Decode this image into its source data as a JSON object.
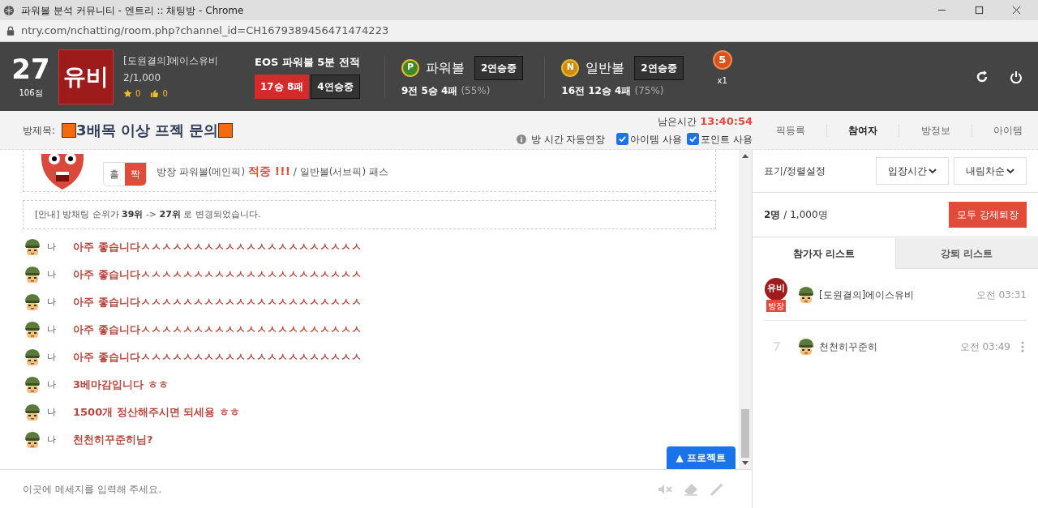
{
  "window": {
    "title": "파워볼 분석 커뮤니티 - 엔트리 :: 채팅방 - Chrome",
    "url": "ntry.com/nchatting/room.php?channel_id=CH1679389456471474223"
  },
  "header": {
    "rank": "27",
    "points": "106점",
    "badge_text": "유비",
    "user_name": "[도원결의]에이스유비",
    "members": "2/1,000",
    "stars": "0",
    "likes": "0",
    "record_title": "EOS 파워볼 5분 전적",
    "record": "17승 8패",
    "record_streak": "4연승중",
    "games": [
      {
        "kind": "powerball",
        "icon_letter": "P",
        "name": "파워볼",
        "streak": "2연승중",
        "stats": "9전 5승 4패",
        "rate": "(55%)"
      },
      {
        "kind": "normal",
        "icon_letter": "N",
        "name": "일반볼",
        "streak": "2연승중",
        "stats": "16전 12승 4패",
        "rate": "(75%)"
      }
    ],
    "medal": {
      "number": "5",
      "count": "x1"
    }
  },
  "room": {
    "title_label": "방제목:",
    "title": "3배목 이상 프젝 문의",
    "remaining_label": "남은시간",
    "remaining": "13:40:54",
    "auto_extend": "방 시간 자동연장",
    "options": [
      {
        "label": "아이템 사용",
        "checked": true
      },
      {
        "label": "포인트 사용",
        "checked": true
      }
    ]
  },
  "side_tabs": [
    {
      "label": "픽등록",
      "selected": false
    },
    {
      "label": "참여자",
      "selected": true
    },
    {
      "label": "방정보",
      "selected": false
    },
    {
      "label": "아이템",
      "selected": false
    }
  ],
  "chat": {
    "result_card": {
      "odd": "홀",
      "even": "짝",
      "even_selected": true,
      "text": "방장 파워볼(메인픽) **적중 !!!** / 일반볼(서브픽) 패스"
    },
    "notice": "[안내] 방채팅 순위가 **39위** -> **27위** 로 변경되었습니다.",
    "messages": [
      {
        "sender": "나",
        "text": "아주 좋습니다ㅅㅅㅅㅅㅅㅅㅅㅅㅅㅅㅅㅅㅅㅅㅅㅅㅅㅅㅅㅅㅅ"
      },
      {
        "sender": "나",
        "text": "아주 좋습니다ㅅㅅㅅㅅㅅㅅㅅㅅㅅㅅㅅㅅㅅㅅㅅㅅㅅㅅㅅㅅㅅ"
      },
      {
        "sender": "나",
        "text": "아주 좋습니다ㅅㅅㅅㅅㅅㅅㅅㅅㅅㅅㅅㅅㅅㅅㅅㅅㅅㅅㅅㅅㅅ"
      },
      {
        "sender": "나",
        "text": "아주 좋습니다ㅅㅅㅅㅅㅅㅅㅅㅅㅅㅅㅅㅅㅅㅅㅅㅅㅅㅅㅅㅅㅅ"
      },
      {
        "sender": "나",
        "text": "아주 좋습니다ㅅㅅㅅㅅㅅㅅㅅㅅㅅㅅㅅㅅㅅㅅㅅㅅㅅㅅㅅㅅㅅ"
      },
      {
        "sender": "나",
        "text": "3베마감입니다 ㅎㅎ"
      },
      {
        "sender": "나",
        "text": "1500개 정산해주시면 되세용 ㅎㅎ"
      },
      {
        "sender": "나",
        "text": "천천히꾸준히님?"
      }
    ],
    "project_button": "▲ 프로젝트",
    "input_placeholder": "이곳에 메세지를 입력해 주세요."
  },
  "participants": {
    "sort_label": "표기/정렬설정",
    "sort_by": "입장시간",
    "order": "내림차순",
    "count": "2명",
    "total": "/ 1,000명",
    "kick_all": "모두 강제퇴장",
    "tabs": [
      {
        "label": "참가자 리스트",
        "selected": true
      },
      {
        "label": "강퇴 리스트",
        "selected": false
      }
    ],
    "list": [
      {
        "name": "[도원결의]에이스유비",
        "time": "오전 03:31",
        "owner": true,
        "owner_badge": "방장",
        "owner_logo": "유비"
      },
      {
        "name": "천천히꾸준히",
        "time": "오전 03:49",
        "owner": false
      }
    ]
  }
}
